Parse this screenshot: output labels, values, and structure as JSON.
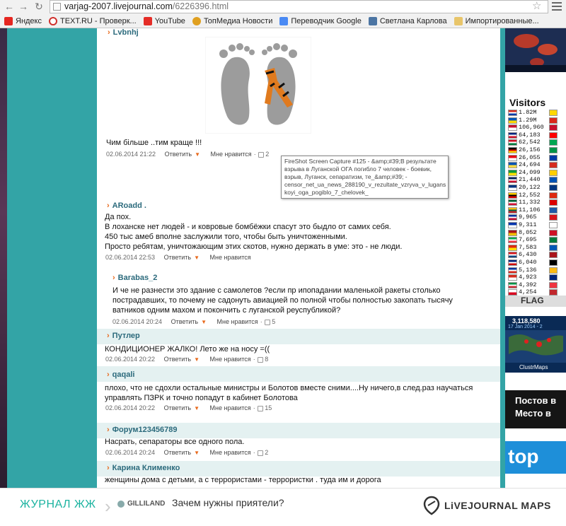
{
  "browser": {
    "url_host": "varjag-2007.livejournal.com",
    "url_path": "/6226396.html",
    "bookmarks": [
      {
        "label": "Яндекс",
        "color": "#e52620"
      },
      {
        "label": "TEXT.RU - Проверк...",
        "color": "#d0312d"
      },
      {
        "label": "YouTube",
        "color": "#e52d27"
      },
      {
        "label": "ТопМедиа Новости",
        "color": "#e0a020"
      },
      {
        "label": "Переводчик Google",
        "color": "#4a8af4"
      },
      {
        "label": "Светлана Карлова",
        "color": "#4c75a3"
      },
      {
        "label": "Импортированные...",
        "color": "#e8c56a"
      }
    ]
  },
  "comments": [
    {
      "author": "Lvbnhj",
      "text": "Чим більше ..тим краще !!!",
      "date": "02.06.2014 21:22",
      "reply": "Ответить",
      "like": "Мне нравится",
      "likes": "2"
    },
    {
      "author": "ARoadd .",
      "lines": [
        "Да пох.",
        "В лоханске нет людей - и ковровые бомбёжки спасут это быдло от самих себя.",
        "450 тыс амеб вполне заслужили того, чтобы быть уничтоженными.",
        "Просто ребятам, уничтожающим этих скотов, нужно держать в уме: это - не люди."
      ],
      "date": "02.06.2014 22:53",
      "reply": "Ответить",
      "like": "Мне нравится",
      "likes": ""
    },
    {
      "author": "Barabas_2",
      "lines": [
        "И че не разнести это здание с самолетов ?если пр ипопадании маленькой ракеты столько",
        "пострадавших, то почему не садонуть авиацией по полной чтобы полностью закопать тысячу",
        "ватников одним махом и покончить с луганской реуспубликой?"
      ],
      "date": "02.06.2014 20:24",
      "reply": "Ответить",
      "like": "Мне нравится",
      "likes": "5"
    },
    {
      "author": "Путлер",
      "text": "КОНДИЦИОНЕР ЖАЛКО! Лето же на носу =((",
      "date": "02.06.2014 20:22",
      "reply": "Ответить",
      "like": "Мне нравится",
      "likes": "8"
    },
    {
      "author": "qaqali",
      "lines": [
        "плохо, что не сдохли остальные министры и Болотов вместе сними....Ну ничего,в след.раз научаться",
        "управлять ПЗРК и точно попадут в кабинет Болотова"
      ],
      "date": "02.06.2014 20:22",
      "reply": "Ответить",
      "like": "Мне нравится",
      "likes": "15"
    },
    {
      "author": "Форум123456789",
      "text": "Насрать, сепараторы все одного пола.",
      "date": "02.06.2014 20:24",
      "reply": "Ответить",
      "like": "Мне нравится",
      "likes": "2"
    },
    {
      "author": "Карина Клименко",
      "text": "женщины дома с детьми, а с террористами - террористки . туда им и дорога",
      "date": "",
      "reply": "",
      "like": "",
      "likes": ""
    }
  ],
  "tooltip": {
    "lines": [
      "FireShot Screen Capture #125 - &amp;#39;В результате",
      "взрыва в Луганской ОГА погибло 7 человек - боевик,",
      "взрыв, Луганск, сепаратизм, те_&amp;#39; -",
      "censor_net_ua_news_288190_v_rezultate_vzryva_v_lugans",
      "koyi_oga_pogiblo_7_chelovek_"
    ]
  },
  "visitors": {
    "title": "Visitors",
    "counts": [
      "1.82M",
      "1.29M",
      "106,960",
      "64,183",
      "62,542",
      "26,156",
      "26,055",
      "24,694",
      "24,099",
      "21,440",
      "20,122",
      "12,552",
      "11,332",
      "11,106",
      "9,965",
      "9,311",
      "8,052",
      "7,695",
      "7,583",
      "6,430",
      "6,040",
      "5,136",
      "4,923",
      "4,392",
      "4,254"
    ],
    "flag_counter": "FLAG",
    "clustrmaps_count": "3,118,580",
    "clustrmaps_date": "17 Jan 2014 - 2",
    "clustrmaps_label": "ClustrMaps",
    "ad_line1": "Постов в",
    "ad_line2": "Место в",
    "top_label": "top"
  },
  "bottom_bar": {
    "logo": "ЖУРНАЛ ЖЖ",
    "user": "GILLILAND",
    "question": "Зачем нужны приятели?",
    "maps": "LiVEJOURNAL MAPS"
  },
  "colors": {
    "teal_bg": "#33a4a6",
    "author": "#2b6a7c",
    "accent": "#e86a1d",
    "lj_green": "#1bb3a0"
  }
}
